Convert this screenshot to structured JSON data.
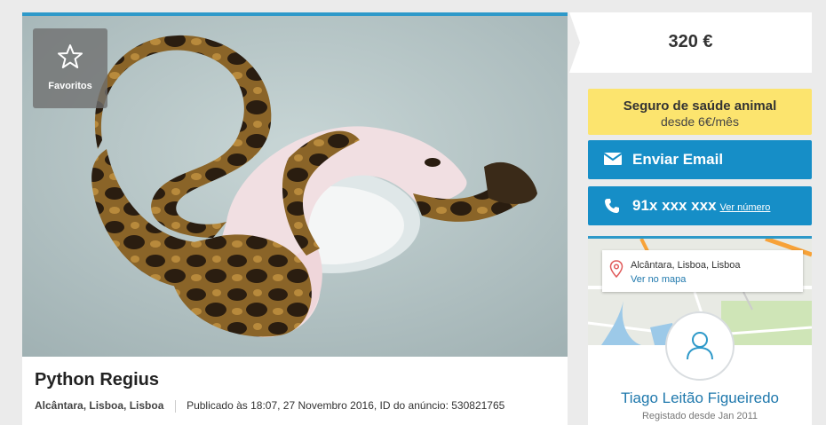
{
  "listing": {
    "favorite_label": "Favoritos",
    "title": "Python Regius",
    "location": "Alcântara, Lisboa, Lisboa",
    "published": "Publicado às 18:07, 27 Novembro 2016, ID do anúncio: 530821765"
  },
  "price": "320 €",
  "insurance": {
    "line1": "Seguro de saúde animal",
    "line2": "desde 6€/mês"
  },
  "contact": {
    "email_label": "Enviar Email",
    "phone_masked": "91x xxx xxx",
    "phone_reveal": "Ver número"
  },
  "seller": {
    "address": "Alcântara, Lisboa, Lisboa",
    "map_link": "Ver no mapa",
    "name": "Tiago Leitão Figueiredo",
    "since": "Registado desde Jan 2011"
  },
  "colors": {
    "accent": "#2e99c9",
    "button": "#168ec7",
    "insurance": "#fce46e",
    "link": "#2079ad"
  }
}
